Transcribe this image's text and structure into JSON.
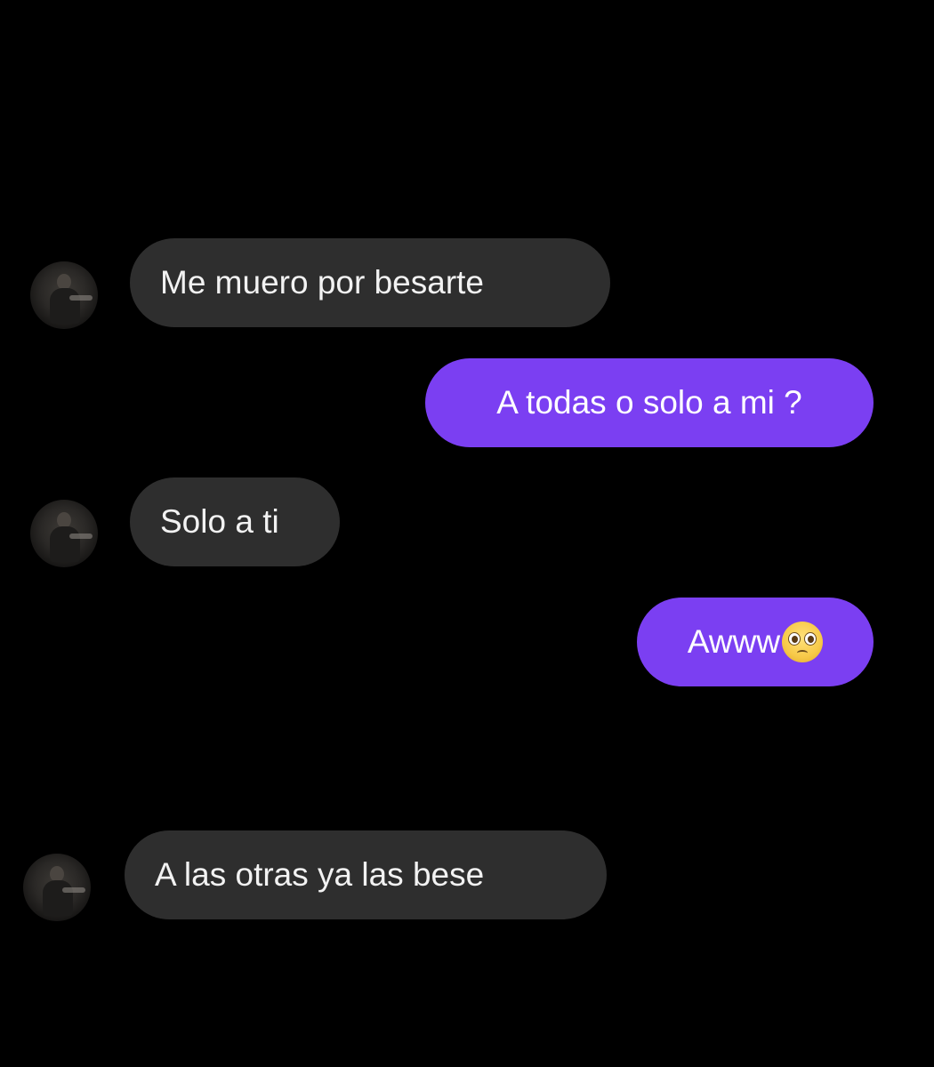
{
  "conversation": {
    "messages": [
      {
        "sender": "contact",
        "text": "Me muero por besarte"
      },
      {
        "sender": "me",
        "text": "A todas o solo a mi ?"
      },
      {
        "sender": "contact",
        "text": "Solo a ti"
      },
      {
        "sender": "me",
        "text": "Awww",
        "emoji": "pleading-face-emoji"
      },
      {
        "sender": "contact",
        "text": "A las otras ya las bese"
      }
    ]
  },
  "colors": {
    "background": "#000000",
    "incoming_bubble": "#2e2e2e",
    "outgoing_bubble": "#7b3ff2",
    "text": "#f2f2f2"
  }
}
